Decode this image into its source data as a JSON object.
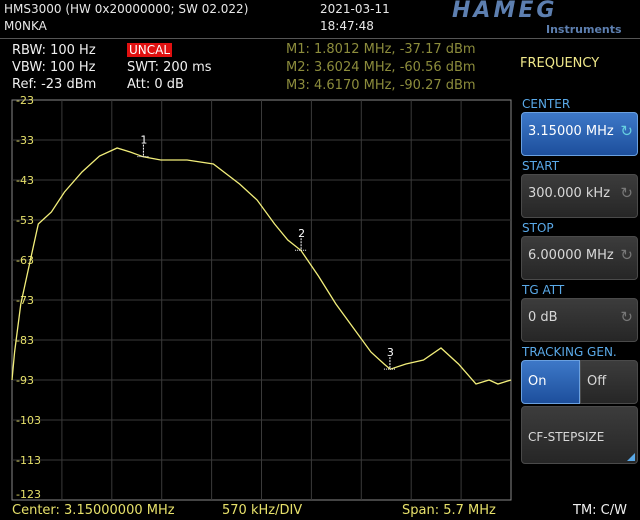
{
  "header": {
    "model": "HMS3000 (HW 0x20000000; SW 02.022)",
    "callsign": "M0NKA",
    "date": "2021-03-11",
    "time": "18:47:48",
    "brand": "HAMEG",
    "brand_sub": "Instruments"
  },
  "settings": {
    "rbw": "RBW: 100 Hz",
    "vbw": "VBW: 100 Hz",
    "ref": "Ref: -23 dBm",
    "uncal": "UNCAL",
    "swt": "SWT: 200 ms",
    "att": "Att: 0 dB"
  },
  "markers": {
    "m1": "M1: 1.8012 MHz, -37.17 dBm",
    "m2": "M2: 3.6024 MHz, -60.56 dBm",
    "m3": "M3: 4.6170 MHz, -90.27 dBm",
    "m1_label": "1",
    "m2_label": "2",
    "m3_label": "3"
  },
  "softkeys": {
    "menu_title": "FREQUENCY",
    "center_title": "CENTER",
    "center_value": "3.15000 MHz",
    "start_title": "START",
    "start_value": "300.000 kHz",
    "stop_title": "STOP",
    "stop_value": "6.00000 MHz",
    "tgatt_title": "TG ATT",
    "tgatt_value": "0 dB",
    "tracking_title": "TRACKING GEN.",
    "on": "On",
    "off": "Off",
    "cf_step": "CF-STEPSIZE"
  },
  "footer": {
    "center": "Center: 3.15000000 MHz",
    "div": "570 kHz/DIV",
    "span": "Span: 5.7 MHz",
    "trace_mode": "TM: C/W"
  },
  "chart_data": {
    "type": "line",
    "y_ticks": [
      "-23",
      "-33",
      "-43",
      "-53",
      "-63",
      "-73",
      "-83",
      "-93",
      "-103",
      "-113",
      "-123"
    ],
    "xlim": [
      0.3,
      6.0
    ],
    "ylim": [
      -123,
      -23
    ],
    "x_unit": "MHz",
    "y_unit": "dBm",
    "grid": true,
    "series": [
      {
        "color": "#f2ee7a",
        "x": [
          0.3,
          0.33,
          0.4,
          0.5,
          0.6,
          0.75,
          0.9,
          1.1,
          1.3,
          1.5,
          1.65,
          1.8,
          2.0,
          2.3,
          2.6,
          2.9,
          3.1,
          3.3,
          3.45,
          3.6,
          3.8,
          4.0,
          4.2,
          4.4,
          4.55,
          4.62,
          4.8,
          5.0,
          5.2,
          5.4,
          5.6,
          5.75,
          5.85,
          6.0
        ],
        "y": [
          -93,
          -86,
          -74,
          -64,
          -54,
          -51,
          -46,
          -41,
          -37,
          -35,
          -36,
          -37.2,
          -38,
          -38,
          -39,
          -44,
          -48,
          -54,
          -58,
          -60.6,
          -67,
          -74,
          -80,
          -86,
          -89,
          -90.3,
          -89,
          -88,
          -85,
          -89,
          -94,
          -93,
          -94,
          -93
        ]
      }
    ],
    "markers": [
      {
        "label": "1",
        "x": 1.8012,
        "y": -37.17
      },
      {
        "label": "2",
        "x": 3.6024,
        "y": -60.56
      },
      {
        "label": "3",
        "x": 4.617,
        "y": -90.27
      }
    ]
  }
}
